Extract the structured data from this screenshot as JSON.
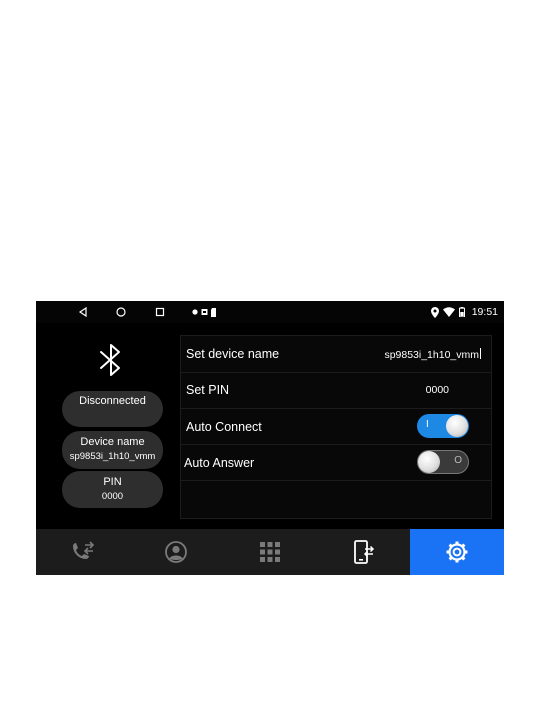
{
  "status_bar": {
    "nav_icons": [
      "back-icon",
      "home-icon",
      "recents-icon"
    ],
    "left_icons": [
      "notification-dot-icon",
      "media-icon",
      "sdcard-icon"
    ],
    "right_icons": [
      "location-icon",
      "wifi-icon",
      "battery-icon"
    ],
    "time": "19:51"
  },
  "left_panel": {
    "icon": "bluetooth-icon",
    "status": "Disconnected",
    "device_name_label": "Device name",
    "device_name_value": "sp9853i_1h10_vmm",
    "pin_label": "PIN",
    "pin_value": "0000"
  },
  "settings": {
    "set_device_name": {
      "label": "Set device name",
      "value": "sp9853i_1h10_vmm"
    },
    "set_pin": {
      "label": "Set PIN",
      "value": "0000"
    },
    "auto_connect": {
      "label": "Auto Connect",
      "state": "on",
      "mark": "I"
    },
    "auto_answer": {
      "label": "Auto Answer",
      "state": "off",
      "mark": "O"
    }
  },
  "bottom_tabs": [
    {
      "icon": "call-transfer-icon",
      "active": false
    },
    {
      "icon": "contacts-icon",
      "active": false
    },
    {
      "icon": "dialpad-icon",
      "active": false
    },
    {
      "icon": "phone-sync-icon",
      "active": false
    },
    {
      "icon": "settings-gear-icon",
      "active": true
    }
  ],
  "colors": {
    "accent": "#1a73f5",
    "toggle_on": "#1e88e5",
    "pill_bg": "#2e2e2e",
    "bar_bg": "#1c1c1c"
  }
}
